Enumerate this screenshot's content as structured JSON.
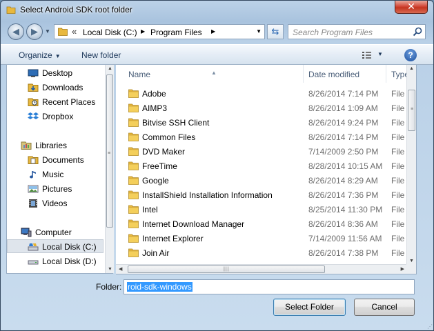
{
  "window": {
    "title": "Select Android SDK root folder",
    "close_label": "✕"
  },
  "address": {
    "segments": [
      "Local Disk (C:)",
      "Program Files"
    ],
    "chevron": "«"
  },
  "search": {
    "placeholder": "Search Program Files"
  },
  "toolbar": {
    "organize": "Organize",
    "new_folder": "New folder",
    "help": "?"
  },
  "nav": {
    "favorites": [
      {
        "label": "Desktop",
        "icon": "desktop-icon"
      },
      {
        "label": "Downloads",
        "icon": "downloads-icon"
      },
      {
        "label": "Recent Places",
        "icon": "recent-places-icon"
      },
      {
        "label": "Dropbox",
        "icon": "dropbox-icon"
      }
    ],
    "libraries_label": "Libraries",
    "libraries": [
      {
        "label": "Documents",
        "icon": "documents-icon"
      },
      {
        "label": "Music",
        "icon": "music-icon"
      },
      {
        "label": "Pictures",
        "icon": "pictures-icon"
      },
      {
        "label": "Videos",
        "icon": "videos-icon"
      }
    ],
    "computer_label": "Computer",
    "drives": [
      {
        "label": "Local Disk (C:)",
        "selected": true
      },
      {
        "label": "Local Disk (D:)",
        "selected": false
      }
    ]
  },
  "columns": {
    "name": "Name",
    "date": "Date modified",
    "type": "Type"
  },
  "files": [
    {
      "name": "Adobe",
      "date": "8/26/2014 7:14 PM",
      "type": "File fold"
    },
    {
      "name": "AIMP3",
      "date": "8/26/2014 1:09 AM",
      "type": "File fold"
    },
    {
      "name": "Bitvise SSH Client",
      "date": "8/26/2014 9:24 PM",
      "type": "File fold"
    },
    {
      "name": "Common Files",
      "date": "8/26/2014 7:14 PM",
      "type": "File fold"
    },
    {
      "name": "DVD Maker",
      "date": "7/14/2009 2:50 PM",
      "type": "File fold"
    },
    {
      "name": "FreeTime",
      "date": "8/28/2014 10:15 AM",
      "type": "File fold"
    },
    {
      "name": "Google",
      "date": "8/26/2014 8:29 AM",
      "type": "File fold"
    },
    {
      "name": "InstallShield Installation Information",
      "date": "8/26/2014 7:36 PM",
      "type": "File fold"
    },
    {
      "name": "Intel",
      "date": "8/25/2014 11:30 PM",
      "type": "File fold"
    },
    {
      "name": "Internet Download Manager",
      "date": "8/26/2014 8:36 AM",
      "type": "File fold"
    },
    {
      "name": "Internet Explorer",
      "date": "7/14/2009 11:56 AM",
      "type": "File fold"
    },
    {
      "name": "Join Air",
      "date": "8/26/2014 7:38 PM",
      "type": "File fold"
    }
  ],
  "footer": {
    "folder_label": "Folder:",
    "folder_value": "roid-sdk-windows",
    "select_label": "Select Folder",
    "cancel_label": "Cancel"
  },
  "colors": {
    "selection": "#3399ff",
    "folder": "#e8b83e",
    "link_text": "#1e395b"
  }
}
